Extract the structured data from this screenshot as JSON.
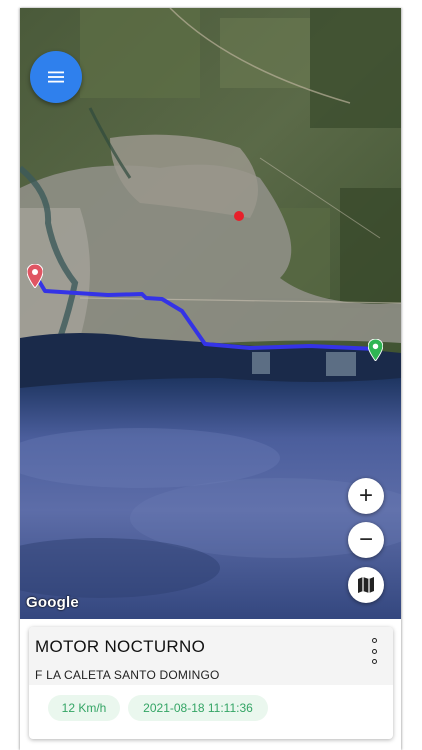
{
  "map": {
    "attribution": "Google",
    "controls": {
      "zoom_in": "+",
      "zoom_out": "−",
      "map_type_icon": "map-icon"
    },
    "menu_icon": "hamburger-icon",
    "route_color": "#3433e6",
    "start_marker_color": "#e05563",
    "end_marker_color": "#2fb553",
    "dot_color": "#e8202a"
  },
  "card": {
    "vehicle_name": "MOTOR NOCTURNO",
    "location": "F LA CALETA SANTO DOMINGO",
    "speed": "12 Km/h",
    "timestamp": "2021-08-18 11:11:36",
    "menu_icon": "more-vert-icon",
    "chip_color": "#34a565"
  }
}
